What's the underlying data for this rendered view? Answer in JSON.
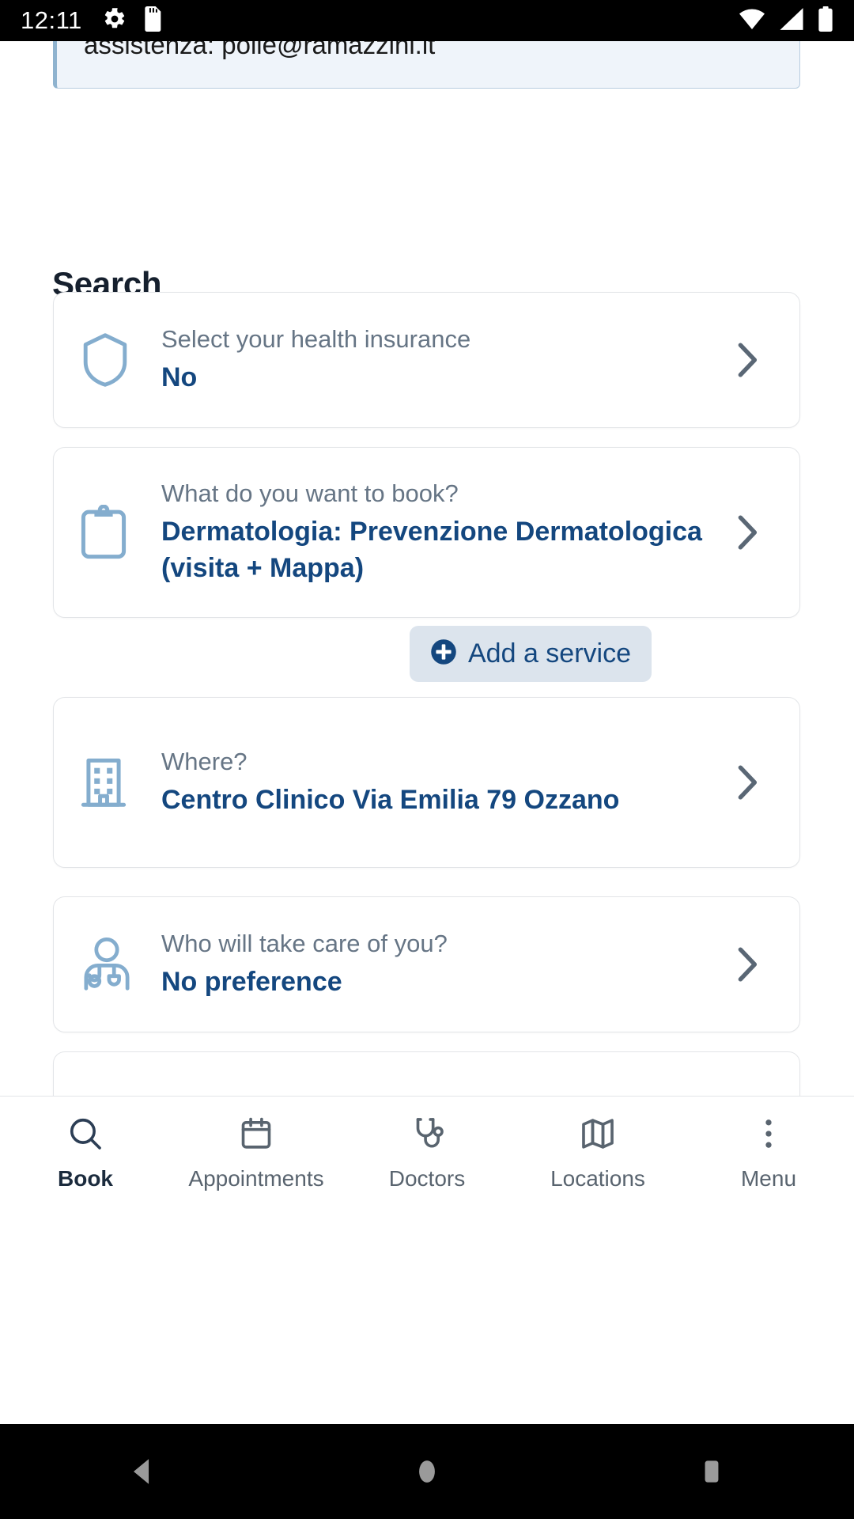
{
  "status_bar": {
    "time": "12:11",
    "left_icons": [
      "gear-icon",
      "sd-card-icon"
    ],
    "right_icons": [
      "wifi-icon",
      "cellular-signal-icon",
      "battery-icon"
    ],
    "background": "#000000"
  },
  "info_box": {
    "text": "assistenza: polie@ramazzini.it",
    "background": "#eff4fa",
    "accent": "#8fb3cf"
  },
  "page": {
    "title": "Search",
    "accent_color": "#14477f",
    "label_color": "#667585"
  },
  "cards": [
    {
      "id": "insurance",
      "icon": "shield-icon",
      "label": "Select your health insurance",
      "value": "No"
    },
    {
      "id": "service",
      "icon": "clipboard-icon",
      "label": "What do you want to book?",
      "value": "Dermatologia: Prevenzione Dermatologica (visita + Mappa)"
    },
    {
      "id": "where",
      "icon": "building-icon",
      "label": "Where?",
      "value": "Centro Clinico Via Emilia 79 Ozzano"
    },
    {
      "id": "doctor",
      "icon": "doctor-icon",
      "label": "Who will take care of you?",
      "value": "No preference"
    }
  ],
  "add_service_chip": {
    "label": "Add a service",
    "icon": "circle-plus-icon",
    "background": "#dce4ed"
  },
  "bottom_nav": {
    "active_index": 0,
    "items": [
      {
        "label": "Book",
        "icon": "search-icon"
      },
      {
        "label": "Appointments",
        "icon": "calendar-icon"
      },
      {
        "label": "Doctors",
        "icon": "stethoscope-icon"
      },
      {
        "label": "Locations",
        "icon": "map-icon"
      },
      {
        "label": "Menu",
        "icon": "overflow-dots-icon"
      }
    ]
  },
  "android_nav": {
    "buttons": [
      "back-icon",
      "home-icon",
      "recents-icon"
    ],
    "background": "#000000"
  }
}
